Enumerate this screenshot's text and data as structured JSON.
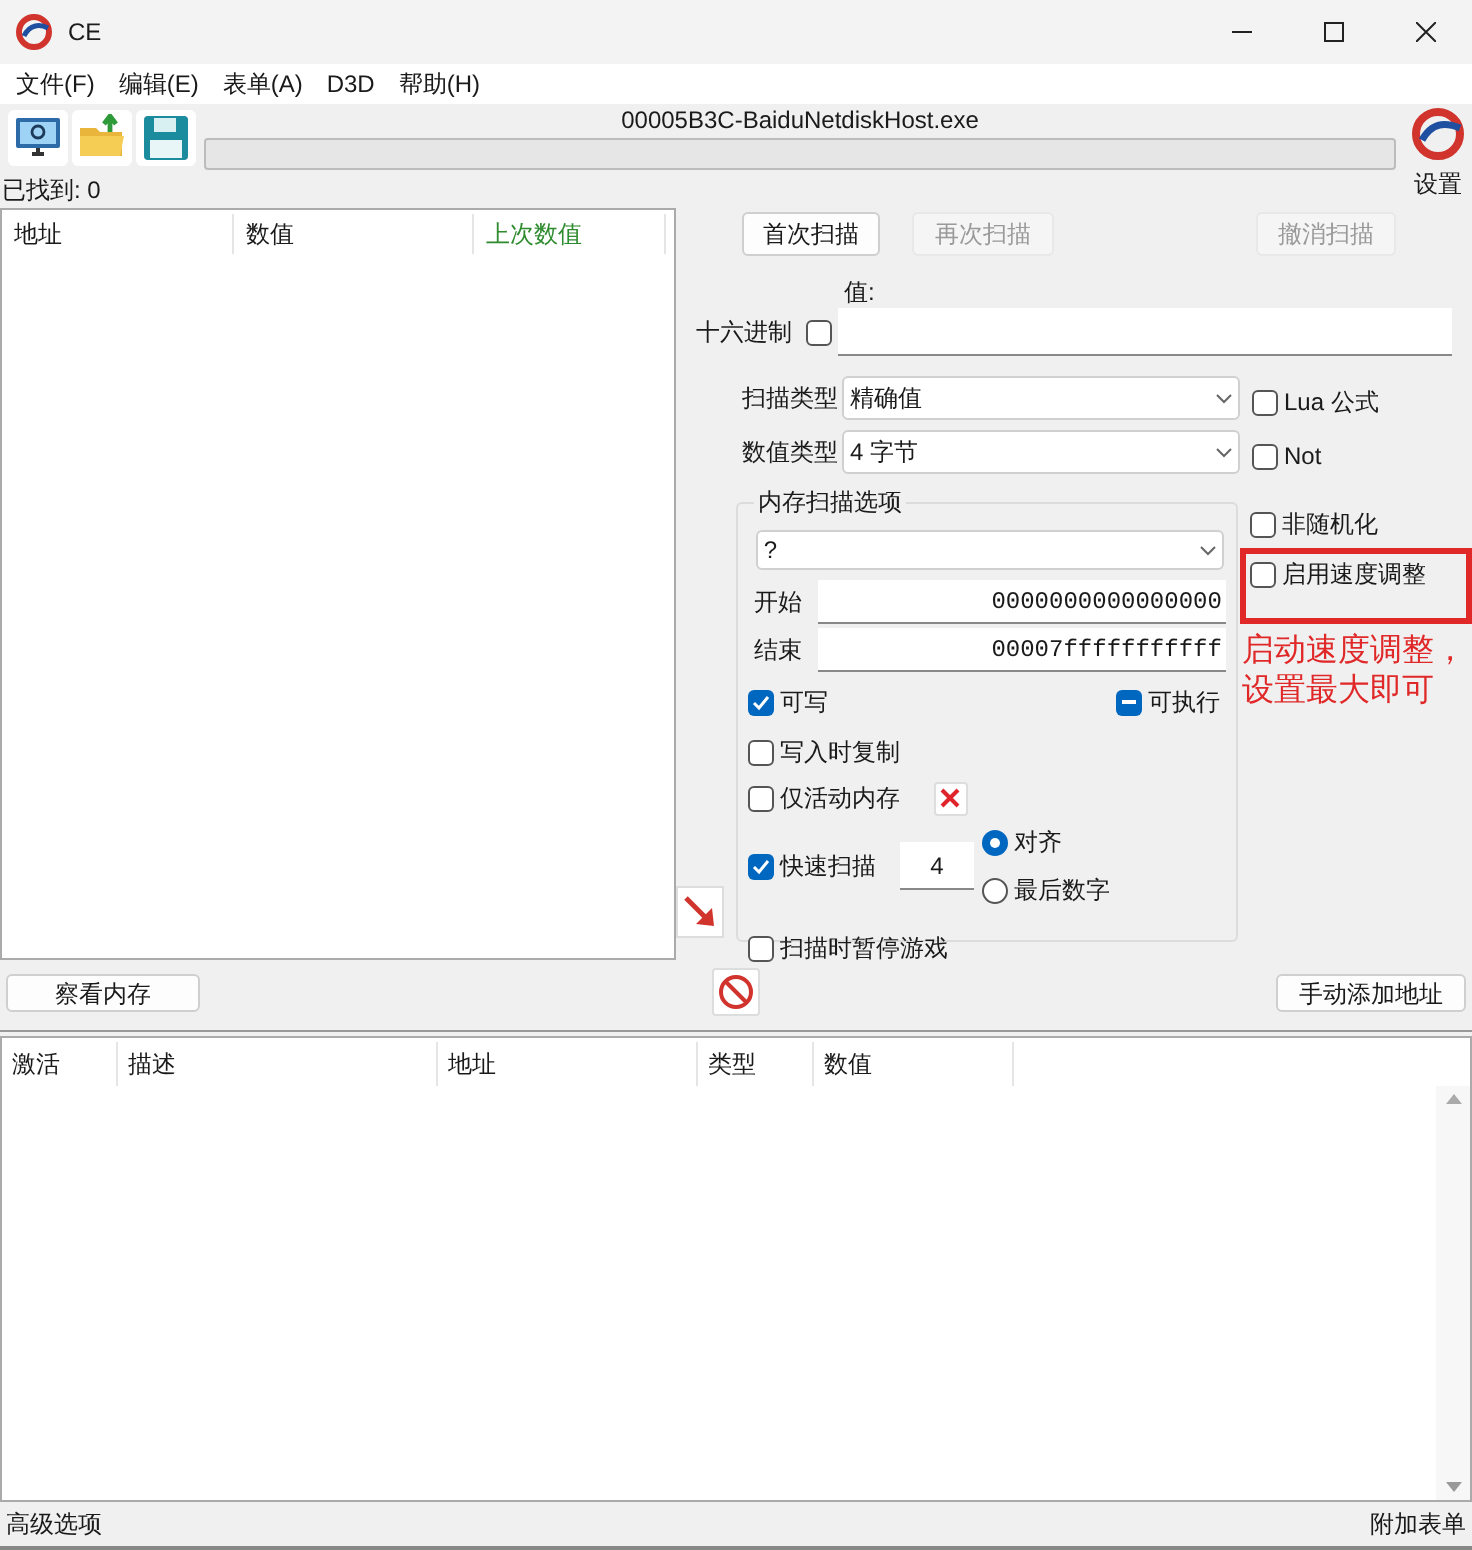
{
  "window": {
    "title": "CE"
  },
  "menu": [
    "文件(F)",
    "编辑(E)",
    "表单(A)",
    "D3D",
    "帮助(H)"
  ],
  "process_title": "00005B3C-BaiduNetdiskHost.exe",
  "scan_progress": {
    "level": 0
  },
  "settings_label": "设置",
  "found_count": "已找到: 0",
  "results_table": {
    "columns": [
      "地址",
      "数值",
      "上次数值"
    ]
  },
  "scan_buttons": [
    {
      "label": "首次扫描",
      "disabled": false
    },
    {
      "label": "再次扫描",
      "disabled": true
    },
    {
      "label": "撤消扫描",
      "disabled": true
    }
  ],
  "value_label": "值:",
  "hex": {
    "label": "十六进制",
    "checked": false
  },
  "scan_type": {
    "label": "扫描类型",
    "value": "精确值"
  },
  "value_type": {
    "label": "数值类型",
    "value": "4 字节"
  },
  "side_options": [
    {
      "label": "Lua 公式",
      "checked": false
    },
    {
      "label": "Not",
      "checked": false
    }
  ],
  "memory_options": {
    "title": "内存扫描选项",
    "region": "?",
    "start": {
      "label": "开始",
      "value": "0000000000000000"
    },
    "stop": {
      "label": "结束",
      "value": "00007fffffffffff"
    },
    "writable": {
      "label": "可写",
      "checked": true
    },
    "executable": {
      "label": "可执行",
      "indeterminate": true
    },
    "copy_on_write": {
      "label": "写入时复制",
      "checked": false
    },
    "active_memory": {
      "label": "仅活动内存",
      "checked": false
    },
    "fast_scan": {
      "label": "快速扫描",
      "checked": true,
      "value": "4"
    },
    "alignment": [
      {
        "label": "对齐",
        "selected": true
      },
      {
        "label": "最后数字",
        "selected": false
      }
    ],
    "pause": {
      "label": "扫描时暂停游戏",
      "checked": false
    }
  },
  "extra_options": [
    {
      "label": "非随机化",
      "checked": false,
      "highlighted": false
    },
    {
      "label": "启用速度调整",
      "checked": false,
      "highlighted": true
    }
  ],
  "annotation": "启动速度调整，设置最大即可",
  "memory_view_button": "察看内存",
  "add_address_button": "手动添加地址",
  "cheat_table": {
    "columns": [
      "激活",
      "描述",
      "地址",
      "类型",
      "数值"
    ]
  },
  "status_bar": {
    "left": "高级选项",
    "right": "附加表单"
  }
}
